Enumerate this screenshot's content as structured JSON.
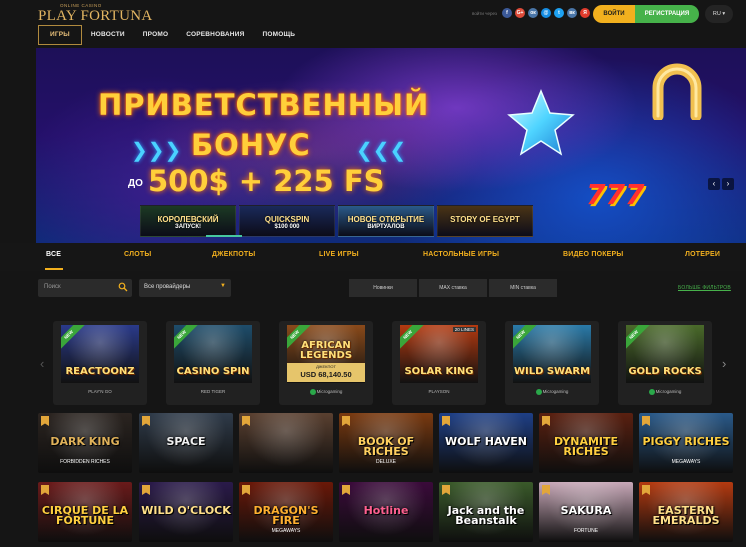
{
  "header": {
    "logo_sub": "ONLINE CASINO",
    "logo_main": "PLAY FORTUNA",
    "nav": [
      "ИГРЫ",
      "НОВОСТИ",
      "ПРОМО",
      "СОРЕВНОВАНИЯ",
      "ПОМОЩЬ"
    ],
    "social_label": "войти через",
    "socials": [
      {
        "name": "facebook-icon",
        "glyph": "f",
        "color": "#3b5998"
      },
      {
        "name": "google-plus-icon",
        "glyph": "G+",
        "color": "#dd4b39"
      },
      {
        "name": "odnoklassniki-icon",
        "glyph": "ок",
        "color": "#4a76a8"
      },
      {
        "name": "mailru-icon",
        "glyph": "@",
        "color": "#168de2"
      },
      {
        "name": "twitter-icon",
        "glyph": "t",
        "color": "#1da1f2"
      },
      {
        "name": "vk-icon",
        "glyph": "вк",
        "color": "#4a76a8"
      },
      {
        "name": "yandex-icon",
        "glyph": "Я",
        "color": "#e03b2c"
      }
    ],
    "login_label": "ВОЙТИ",
    "register_label": "РЕГИСТРАЦИЯ",
    "language": "RU",
    "colors": {
      "login": "#f2b01e",
      "register": "#46b24a",
      "accent": "#e2b562"
    }
  },
  "banner": {
    "line1": "ПРИВЕТСТВЕННЫЙ",
    "line2": "БОНУС",
    "prefix": "ДО",
    "amount": "500$ + 225 FS",
    "slot_symbol": "777",
    "thumbs": [
      {
        "title": "КОРОЛЕВСКИЙ",
        "sub": "ЗАПУСК!",
        "bg": "#1c3a24"
      },
      {
        "title": "QUICKSPIN",
        "sub": "$100 000",
        "bg": "#1a2a5a"
      },
      {
        "title": "НОВОЕ ОТКРЫТИЕ",
        "sub": "ВИРТУАЛОВ",
        "bg": "#2a5a8a"
      },
      {
        "title": "STORY OF EGYPT",
        "sub": "",
        "bg": "#4a3416"
      }
    ]
  },
  "categories": [
    "ВСЕ",
    "СЛОТЫ",
    "ДЖЕКПОТЫ",
    "LIVE ИГРЫ",
    "НАСТОЛЬНЫЕ ИГРЫ",
    "ВИДЕО ПОКЕРЫ",
    "ЛОТЕРЕИ"
  ],
  "filters": {
    "search_placeholder": "Поиск",
    "provider_value": "Все провайдеры",
    "sort": [
      "Новинки",
      "MAX ставка",
      "MIN ставка"
    ],
    "more_filters": "БОЛЬШЕ ФИЛЬТРОВ"
  },
  "featured": [
    {
      "title": "REACTOONZ",
      "provider": "PLAY'N GO",
      "badge": "NEW",
      "bg": "#2a3a8a"
    },
    {
      "title": "CASINO SPIN",
      "provider": "RED TIGER",
      "badge": "NEW",
      "bg": "#1e4d6b"
    },
    {
      "title": "AFRICAN LEGENDS",
      "provider": "Microgaming",
      "badge": "NEW",
      "jackpot_label": "ДЖЕКПОТ",
      "jackpot_value": "USD 68,140.50",
      "bg": "#8a4a1a"
    },
    {
      "title": "SOLAR KING",
      "provider": "PLAYSON",
      "badge": "NEW",
      "lines": "20 LINES",
      "bg": "#b43a10"
    },
    {
      "title": "WILD SWARM",
      "provider": "Microgaming",
      "badge": "NEW",
      "bg": "#2a7aa8"
    },
    {
      "title": "GOLD ROCKS",
      "provider": "Microgaming",
      "badge": "NEW",
      "bg": "#4a6a2a"
    }
  ],
  "grid": [
    {
      "title": "DARK KING",
      "sub": "FORBIDDEN RICHES",
      "bg": "#2b2420",
      "color": "#e0b25a"
    },
    {
      "title": "SPACE",
      "sub": "",
      "bg": "#2f3b4a",
      "color": "#f0f0f0"
    },
    {
      "title": "",
      "sub": "",
      "bg": "#5a4030",
      "color": "#ddd"
    },
    {
      "title": "BOOK OF RICHES",
      "sub": "DELUXE",
      "bg": "#7a3a10",
      "color": "#ffd060"
    },
    {
      "title": "WOLF HAVEN",
      "sub": "",
      "bg": "#1e3f86",
      "color": "#ffffff"
    },
    {
      "title": "DYNAMITE RICHES",
      "sub": "",
      "bg": "#5a2010",
      "color": "#ffcf40"
    },
    {
      "title": "PIGGY RICHES",
      "sub": "MEGAWAYS",
      "bg": "#2a5a8a",
      "color": "#ffcf40"
    },
    {
      "title": "CIRQUE DE LA FORTUNE",
      "sub": "",
      "bg": "#6a1a1a",
      "color": "#ffcf40"
    },
    {
      "title": "WILD O'CLOCK",
      "sub": "",
      "bg": "#2a1a4a",
      "color": "#ffe08a"
    },
    {
      "title": "DRAGON'S FIRE",
      "sub": "MEGAWAYS",
      "bg": "#6a1808",
      "color": "#ffb030"
    },
    {
      "title": "Hotline",
      "sub": "",
      "bg": "#3a0a3a",
      "color": "#ff6090"
    },
    {
      "title": "Jack and the Beanstalk",
      "sub": "",
      "bg": "#3a5a2a",
      "color": "#ffffff"
    },
    {
      "title": "SAKURA",
      "sub": "FORTUNE",
      "bg": "#c8a8b8",
      "color": "#ffffff"
    },
    {
      "title": "EASTERN EMERALDS",
      "sub": "",
      "bg": "#b43a10",
      "color": "#ffe08a"
    }
  ]
}
